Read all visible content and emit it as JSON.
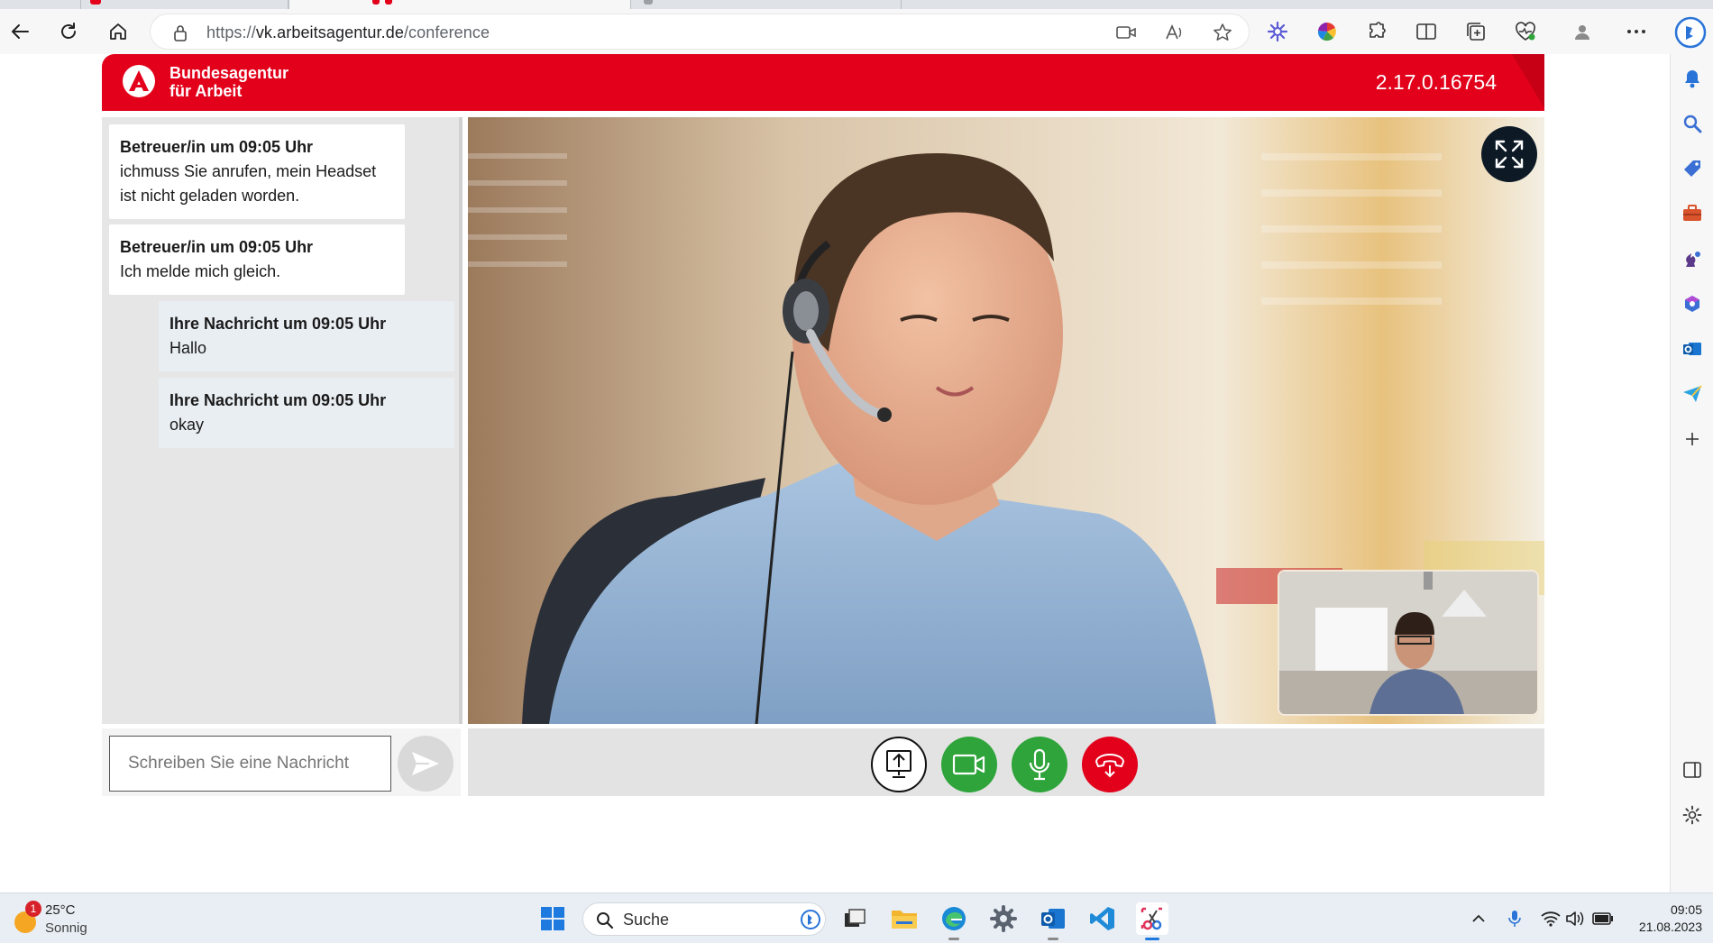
{
  "browser": {
    "url_scheme": "https://",
    "url_host": "vk.arbeitsagentur.de",
    "url_path": "/conference"
  },
  "header": {
    "org_line1": "Bundesagentur",
    "org_line2": "für Arbeit",
    "version": "2.17.0.16754"
  },
  "chat": {
    "messages": [
      {
        "sender": "Betreuer/in um 09:05 Uhr",
        "text": "ichmuss Sie anrufen, mein Headset ist nicht geladen worden."
      },
      {
        "sender": "Betreuer/in um 09:05 Uhr",
        "text": "Ich melde mich gleich."
      },
      {
        "sender": "Ihre Nachricht um 09:05 Uhr",
        "text": "Hallo"
      },
      {
        "sender": "Ihre Nachricht um 09:05 Uhr",
        "text": "okay"
      }
    ],
    "input_placeholder": "Schreiben Sie eine Nachricht"
  },
  "controls": [
    {
      "name": "screen-share",
      "icon": "screen-share-icon",
      "color": "#ffffff"
    },
    {
      "name": "camera",
      "icon": "video-camera-icon",
      "color": "#2ea43a"
    },
    {
      "name": "microphone",
      "icon": "microphone-icon",
      "color": "#2ea43a"
    },
    {
      "name": "hang-up",
      "icon": "hang-up-icon",
      "color": "#e2001a"
    }
  ],
  "colors": {
    "brand_red": "#e2001a",
    "control_green": "#2ea43a"
  },
  "taskbar": {
    "weather_temp": "25°C",
    "weather_condition": "Sonnig",
    "weather_badge": "1",
    "search_label": "Suche",
    "time": "09:05",
    "date": "21.08.2023"
  }
}
